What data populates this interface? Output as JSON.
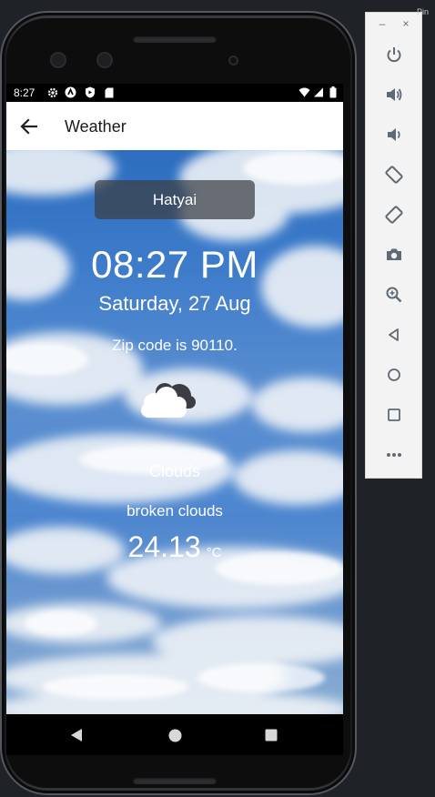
{
  "status_bar": {
    "time": "8:27"
  },
  "app_bar": {
    "title": "Weather"
  },
  "weather": {
    "city": "Hatyai",
    "time": "08:27 PM",
    "date": "Saturday, 27 Aug",
    "zip_text": "Zip code is 90110.",
    "main": "Clouds",
    "description": "broken clouds",
    "temperature": "24.13",
    "unit": "°C",
    "icon": "broken-clouds-icon"
  },
  "emulator_panel": {
    "minimize": "–",
    "close": "×",
    "pin": "Pin",
    "buttons": [
      "power-icon",
      "volume-up-icon",
      "volume-down-icon",
      "rotate-left-icon",
      "rotate-right-icon",
      "camera-icon",
      "zoom-icon",
      "back-icon",
      "home-icon",
      "overview-icon",
      "more-icon"
    ]
  }
}
